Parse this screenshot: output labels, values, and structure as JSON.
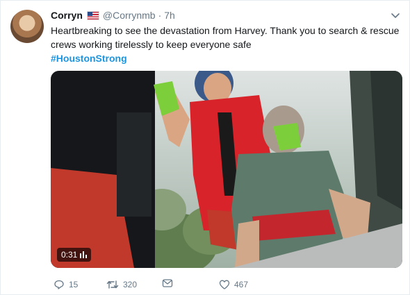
{
  "tweet": {
    "author_name": "Corryn",
    "author_handle": "@Corrynmb",
    "separator": "·",
    "time": "7h",
    "text": "Heartbreaking to see the devastation from Harvey. Thank you to search & rescue crews working tirelessly to keep everyone safe",
    "hashtag": "#HoustonStrong",
    "video_duration": "0:31"
  },
  "actions": {
    "reply_count": "15",
    "retweet_count": "320",
    "like_count": "467"
  },
  "icons": {
    "flag": "us-flag-icon",
    "chevron": "chevron-down-icon",
    "reply": "reply-icon",
    "retweet": "retweet-icon",
    "direct_message": "direct-message-icon",
    "like": "heart-icon",
    "video_stats": "bar-chart-icon"
  },
  "colors": {
    "link": "#1b95e0",
    "secondary_text": "#657786",
    "primary_text": "#14171a"
  }
}
